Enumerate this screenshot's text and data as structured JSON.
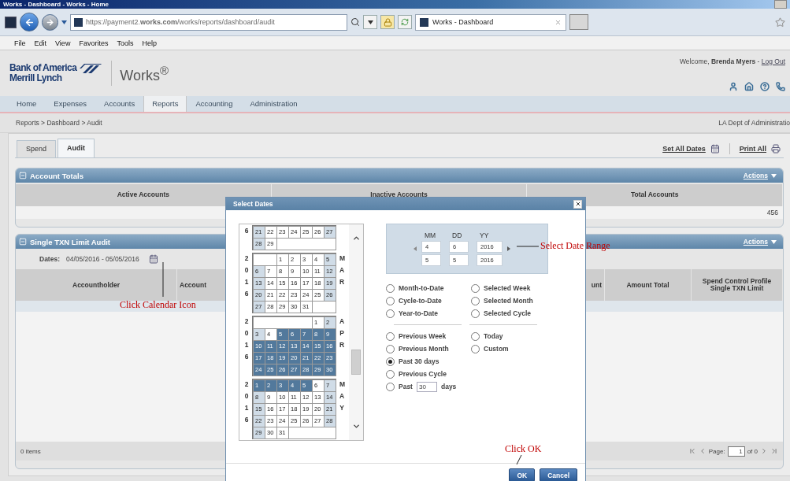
{
  "browser": {
    "title": "Works - Dashboard - Works - Home",
    "url": "https://payment2.**works.com**/works/reports/dashboard/audit",
    "tab_title": "Works - Dashboard",
    "menu": [
      "File",
      "Edit",
      "View",
      "Favorites",
      "Tools",
      "Help"
    ]
  },
  "header": {
    "brand_line1": "Bank of America",
    "brand_line2": "Merrill Lynch",
    "product": "Works$^{®}$",
    "welcome": "Welcome, **Brenda Myers** -",
    "logout": "Log Out"
  },
  "nav": [
    {
      "label": "Home",
      "selected": false
    },
    {
      "label": "Expenses",
      "selected": false
    },
    {
      "label": "Accounts",
      "selected": false
    },
    {
      "label": "Reports",
      "selected": true
    },
    {
      "label": "Accounting",
      "selected": false
    },
    {
      "label": "Administration",
      "selected": false
    }
  ],
  "breadcrumb": "Reports > Dashboard > Audit",
  "organization": "LA Dept of Administratio",
  "tabs": [
    {
      "label": "Spend",
      "selected": false
    },
    {
      "label": "Audit",
      "selected": true
    }
  ],
  "set_all_dates": "Set All Dates",
  "print_all": "Print All",
  "account_totals": {
    "title": "Account Totals",
    "actions": "Actions",
    "columns": [
      "Active Accounts",
      "Inactive Accounts",
      "Total Accounts"
    ],
    "total_value": "456"
  },
  "audit": {
    "title": "Single TXN Limit Audit",
    "actions": "Actions",
    "dates_label": "Dates:",
    "dates_value": "04/05/2016 - 05/05/2016",
    "columns": [
      "Accountholder",
      "Account",
      "unt",
      "Amount Total",
      "Spend Control Profile Single TXN Limit"
    ],
    "items": "0 items",
    "page_label": "Page:",
    "page": "1",
    "page_of": "of 0"
  },
  "dialog": {
    "title": "Select Dates",
    "months": [
      {
        "year": "6",
        "weeks": [
          [
            {
              "day": "21",
              "selected": false
            },
            {
              "day": "22",
              "selected": false
            },
            {
              "day": "23",
              "selected": false
            },
            {
              "day": "24",
              "selected": false
            },
            {
              "day": "25",
              "selected": false
            },
            {
              "day": "26",
              "selected": false
            },
            {
              "day": "27",
              "selected": false
            }
          ],
          [
            {
              "day": "28",
              "selected": false
            },
            {
              "day": "29",
              "selected": false
            }
          ]
        ]
      },
      {
        "year": "2016",
        "month": "MAR",
        "weeks": [
          [
            {
              "day": "1",
              "selected": false
            },
            {
              "day": "2",
              "selected": false
            },
            {
              "day": "3",
              "selected": false
            },
            {
              "day": "4",
              "selected": false
            },
            {
              "day": "5",
              "selected": false
            }
          ],
          [
            {
              "day": "6",
              "selected": false
            },
            {
              "day": "7",
              "selected": false
            },
            {
              "day": "8",
              "selected": false
            },
            {
              "day": "9",
              "selected": false
            },
            {
              "day": "10",
              "selected": false
            },
            {
              "day": "11",
              "selected": false
            },
            {
              "day": "12",
              "selected": false
            }
          ],
          [
            {
              "day": "13",
              "selected": false
            },
            {
              "day": "14",
              "selected": false
            },
            {
              "day": "15",
              "selected": false
            },
            {
              "day": "16",
              "selected": false
            },
            {
              "day": "17",
              "selected": false
            },
            {
              "day": "18",
              "selected": false
            },
            {
              "day": "19",
              "selected": false
            }
          ],
          [
            {
              "day": "20",
              "selected": false
            },
            {
              "day": "21",
              "selected": false
            },
            {
              "day": "22",
              "selected": false
            },
            {
              "day": "23",
              "selected": false
            },
            {
              "day": "24",
              "selected": false
            },
            {
              "day": "25",
              "selected": false
            },
            {
              "day": "26",
              "selected": false
            }
          ],
          [
            {
              "day": "27",
              "selected": false
            },
            {
              "day": "28",
              "selected": false
            },
            {
              "day": "29",
              "selected": false
            },
            {
              "day": "30",
              "selected": false
            },
            {
              "day": "31",
              "selected": false
            }
          ]
        ]
      },
      {
        "year": "2016",
        "month": "APR",
        "weeks": [
          [
            {
              "day": "1",
              "selected": false
            },
            {
              "day": "2",
              "selected": false
            }
          ],
          [
            {
              "day": "3",
              "selected": false
            },
            {
              "day": "4",
              "selected": false
            },
            {
              "day": "5",
              "selected": true
            },
            {
              "day": "6",
              "selected": true
            },
            {
              "day": "7",
              "selected": true
            },
            {
              "day": "8",
              "selected": true
            },
            {
              "day": "9",
              "selected": true
            }
          ],
          [
            {
              "day": "10",
              "selected": true
            },
            {
              "day": "11",
              "selected": true
            },
            {
              "day": "12",
              "selected": true
            },
            {
              "day": "13",
              "selected": true
            },
            {
              "day": "14",
              "selected": true
            },
            {
              "day": "15",
              "selected": true
            },
            {
              "day": "16",
              "selected": true
            }
          ],
          [
            {
              "day": "17",
              "selected": true
            },
            {
              "day": "18",
              "selected": true
            },
            {
              "day": "19",
              "selected": true
            },
            {
              "day": "20",
              "selected": true
            },
            {
              "day": "21",
              "selected": true
            },
            {
              "day": "22",
              "selected": true
            },
            {
              "day": "23",
              "selected": true
            }
          ],
          [
            {
              "day": "24",
              "selected": true
            },
            {
              "day": "25",
              "selected": true
            },
            {
              "day": "26",
              "selected": true
            },
            {
              "day": "27",
              "selected": true
            },
            {
              "day": "28",
              "selected": true
            },
            {
              "day": "29",
              "selected": true
            },
            {
              "day": "30",
              "selected": true
            }
          ]
        ]
      },
      {
        "year": "2016",
        "month": "MAY",
        "weeks": [
          [
            {
              "day": "1",
              "selected": true
            },
            {
              "day": "2",
              "selected": true
            },
            {
              "day": "3",
              "selected": true
            },
            {
              "day": "4",
              "selected": true
            },
            {
              "day": "5",
              "selected": true
            },
            {
              "day": "6",
              "selected": false
            },
            {
              "day": "7",
              "selected": false
            }
          ],
          [
            {
              "day": "8",
              "selected": false
            },
            {
              "day": "9",
              "selected": false
            },
            {
              "day": "10",
              "selected": false
            },
            {
              "day": "11",
              "selected": false
            },
            {
              "day": "12",
              "selected": false
            },
            {
              "day": "13",
              "selected": false
            },
            {
              "day": "14",
              "selected": false
            }
          ],
          [
            {
              "day": "15",
              "selected": false
            },
            {
              "day": "16",
              "selected": false
            },
            {
              "day": "17",
              "selected": false
            },
            {
              "day": "18",
              "selected": false
            },
            {
              "day": "19",
              "selected": false
            },
            {
              "day": "20",
              "selected": false
            },
            {
              "day": "21",
              "selected": false
            }
          ],
          [
            {
              "day": "22",
              "selected": false
            },
            {
              "day": "23",
              "selected": false
            },
            {
              "day": "24",
              "selected": false
            },
            {
              "day": "25",
              "selected": false
            },
            {
              "day": "26",
              "selected": false
            },
            {
              "day": "27",
              "selected": false
            },
            {
              "day": "28",
              "selected": false
            }
          ],
          [
            {
              "day": "29",
              "selected": false
            },
            {
              "day": "30",
              "selected": false
            },
            {
              "day": "31",
              "selected": false
            }
          ]
        ]
      }
    ],
    "date_range": {
      "labels": [
        "MM",
        "DD",
        "YY"
      ],
      "rows": [
        [
          "4",
          "6",
          "2016"
        ],
        [
          "5",
          "5",
          "2016"
        ]
      ]
    },
    "presets": [
      {
        "left": [
          {
            "kind": "plain",
            "label": "Month-to-Date",
            "selected": false
          },
          {
            "kind": "plain",
            "label": "Cycle-to-Date",
            "selected": false
          },
          {
            "kind": "plain",
            "label": "Year-to-Date",
            "selected": false
          }
        ],
        "right": [
          {
            "kind": "plain",
            "label": "Selected Week",
            "selected": false
          },
          {
            "kind": "plain",
            "label": "Selected Month",
            "selected": false
          },
          {
            "kind": "plain",
            "label": "Selected Cycle",
            "selected": false
          }
        ]
      },
      {
        "left": [
          {
            "kind": "plain",
            "label": "Previous Week",
            "selected": false
          },
          {
            "kind": "plain",
            "label": "Previous Month",
            "selected": false
          },
          {
            "kind": "plain",
            "label": "Past 30 days",
            "selected": true
          },
          {
            "kind": "plain",
            "label": "Previous Cycle",
            "selected": false
          },
          {
            "kind": "days",
            "label": "Past",
            "value": "30",
            "suffix": "days",
            "selected": false
          }
        ],
        "right": [
          {
            "kind": "plain",
            "label": "Today",
            "selected": false
          },
          {
            "kind": "plain",
            "label": "Custom",
            "selected": false
          }
        ]
      }
    ],
    "buttons": [
      "OK",
      "Cancel"
    ]
  },
  "annotations": [
    {
      "kind": "calendar",
      "text": "Click Calendar Icon"
    },
    {
      "kind": "range",
      "text": "Select Date Range"
    },
    {
      "kind": "ok",
      "text": "Click OK"
    }
  ]
}
